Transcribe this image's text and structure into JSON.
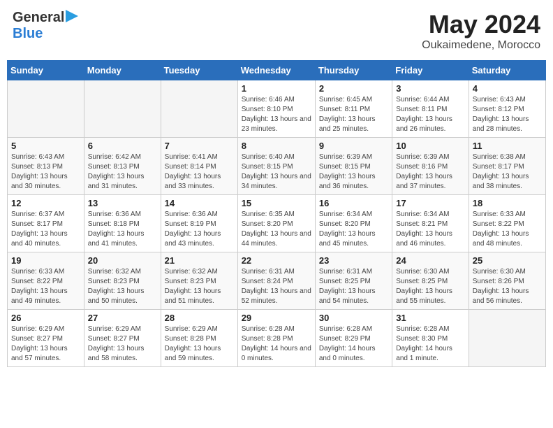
{
  "header": {
    "logo_general": "General",
    "logo_blue": "Blue",
    "month_title": "May 2024",
    "location": "Oukaimedene, Morocco"
  },
  "days_of_week": [
    "Sunday",
    "Monday",
    "Tuesday",
    "Wednesday",
    "Thursday",
    "Friday",
    "Saturday"
  ],
  "weeks": [
    [
      {
        "day": "",
        "info": ""
      },
      {
        "day": "",
        "info": ""
      },
      {
        "day": "",
        "info": ""
      },
      {
        "day": "1",
        "info": "Sunrise: 6:46 AM\nSunset: 8:10 PM\nDaylight: 13 hours and 23 minutes."
      },
      {
        "day": "2",
        "info": "Sunrise: 6:45 AM\nSunset: 8:11 PM\nDaylight: 13 hours and 25 minutes."
      },
      {
        "day": "3",
        "info": "Sunrise: 6:44 AM\nSunset: 8:11 PM\nDaylight: 13 hours and 26 minutes."
      },
      {
        "day": "4",
        "info": "Sunrise: 6:43 AM\nSunset: 8:12 PM\nDaylight: 13 hours and 28 minutes."
      }
    ],
    [
      {
        "day": "5",
        "info": "Sunrise: 6:43 AM\nSunset: 8:13 PM\nDaylight: 13 hours and 30 minutes."
      },
      {
        "day": "6",
        "info": "Sunrise: 6:42 AM\nSunset: 8:13 PM\nDaylight: 13 hours and 31 minutes."
      },
      {
        "day": "7",
        "info": "Sunrise: 6:41 AM\nSunset: 8:14 PM\nDaylight: 13 hours and 33 minutes."
      },
      {
        "day": "8",
        "info": "Sunrise: 6:40 AM\nSunset: 8:15 PM\nDaylight: 13 hours and 34 minutes."
      },
      {
        "day": "9",
        "info": "Sunrise: 6:39 AM\nSunset: 8:15 PM\nDaylight: 13 hours and 36 minutes."
      },
      {
        "day": "10",
        "info": "Sunrise: 6:39 AM\nSunset: 8:16 PM\nDaylight: 13 hours and 37 minutes."
      },
      {
        "day": "11",
        "info": "Sunrise: 6:38 AM\nSunset: 8:17 PM\nDaylight: 13 hours and 38 minutes."
      }
    ],
    [
      {
        "day": "12",
        "info": "Sunrise: 6:37 AM\nSunset: 8:17 PM\nDaylight: 13 hours and 40 minutes."
      },
      {
        "day": "13",
        "info": "Sunrise: 6:36 AM\nSunset: 8:18 PM\nDaylight: 13 hours and 41 minutes."
      },
      {
        "day": "14",
        "info": "Sunrise: 6:36 AM\nSunset: 8:19 PM\nDaylight: 13 hours and 43 minutes."
      },
      {
        "day": "15",
        "info": "Sunrise: 6:35 AM\nSunset: 8:20 PM\nDaylight: 13 hours and 44 minutes."
      },
      {
        "day": "16",
        "info": "Sunrise: 6:34 AM\nSunset: 8:20 PM\nDaylight: 13 hours and 45 minutes."
      },
      {
        "day": "17",
        "info": "Sunrise: 6:34 AM\nSunset: 8:21 PM\nDaylight: 13 hours and 46 minutes."
      },
      {
        "day": "18",
        "info": "Sunrise: 6:33 AM\nSunset: 8:22 PM\nDaylight: 13 hours and 48 minutes."
      }
    ],
    [
      {
        "day": "19",
        "info": "Sunrise: 6:33 AM\nSunset: 8:22 PM\nDaylight: 13 hours and 49 minutes."
      },
      {
        "day": "20",
        "info": "Sunrise: 6:32 AM\nSunset: 8:23 PM\nDaylight: 13 hours and 50 minutes."
      },
      {
        "day": "21",
        "info": "Sunrise: 6:32 AM\nSunset: 8:23 PM\nDaylight: 13 hours and 51 minutes."
      },
      {
        "day": "22",
        "info": "Sunrise: 6:31 AM\nSunset: 8:24 PM\nDaylight: 13 hours and 52 minutes."
      },
      {
        "day": "23",
        "info": "Sunrise: 6:31 AM\nSunset: 8:25 PM\nDaylight: 13 hours and 54 minutes."
      },
      {
        "day": "24",
        "info": "Sunrise: 6:30 AM\nSunset: 8:25 PM\nDaylight: 13 hours and 55 minutes."
      },
      {
        "day": "25",
        "info": "Sunrise: 6:30 AM\nSunset: 8:26 PM\nDaylight: 13 hours and 56 minutes."
      }
    ],
    [
      {
        "day": "26",
        "info": "Sunrise: 6:29 AM\nSunset: 8:27 PM\nDaylight: 13 hours and 57 minutes."
      },
      {
        "day": "27",
        "info": "Sunrise: 6:29 AM\nSunset: 8:27 PM\nDaylight: 13 hours and 58 minutes."
      },
      {
        "day": "28",
        "info": "Sunrise: 6:29 AM\nSunset: 8:28 PM\nDaylight: 13 hours and 59 minutes."
      },
      {
        "day": "29",
        "info": "Sunrise: 6:28 AM\nSunset: 8:28 PM\nDaylight: 14 hours and 0 minutes."
      },
      {
        "day": "30",
        "info": "Sunrise: 6:28 AM\nSunset: 8:29 PM\nDaylight: 14 hours and 0 minutes."
      },
      {
        "day": "31",
        "info": "Sunrise: 6:28 AM\nSunset: 8:30 PM\nDaylight: 14 hours and 1 minute."
      },
      {
        "day": "",
        "info": ""
      }
    ]
  ]
}
